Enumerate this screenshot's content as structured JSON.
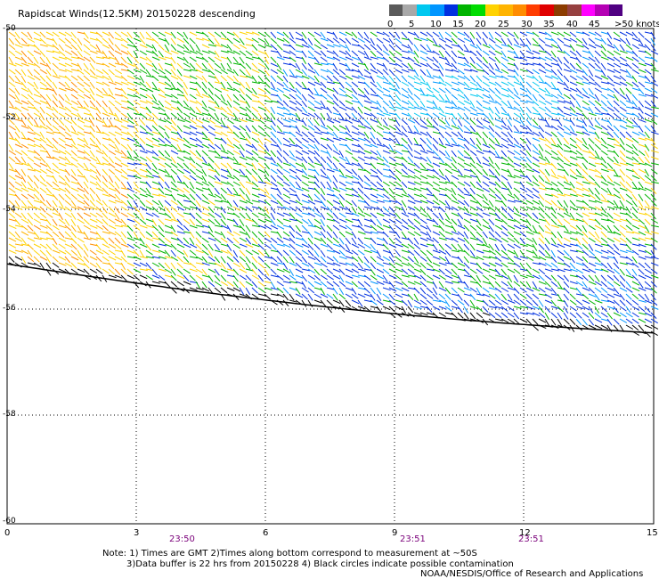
{
  "title": "Rapidscat Winds(12.5KM) 20150228 descending",
  "legend": {
    "colors": [
      "#5a5a5a",
      "#a8a8a8",
      "#00c8f0",
      "#0096ff",
      "#0030e0",
      "#00b400",
      "#00dc00",
      "#ffd200",
      "#ffb400",
      "#ff8c00",
      "#ff3c00",
      "#e00000",
      "#8c3c00",
      "#964040",
      "#ff00ff",
      "#b400b4",
      "#500082"
    ],
    "labels": [
      "0",
      "5",
      "10",
      "15",
      "20",
      "25",
      "30",
      "35",
      "40",
      "45",
      ">50 knots"
    ]
  },
  "y_axis": {
    "labels": [
      "-50",
      "-52",
      "-54",
      "-56",
      "-58",
      "-60"
    ]
  },
  "x_axis": {
    "labels": [
      "0",
      "3",
      "6",
      "9",
      "12",
      "15"
    ]
  },
  "times": [
    "23:50",
    "23:51",
    "23:51"
  ],
  "notes": [
    "Note: 1) Times are GMT 2)Times along bottom correspond to measurement at ~50S",
    "3)Data buffer is 22 hrs from 20150228 4) Black circles indicate possible contamination"
  ],
  "credit": "NOAA/NESDIS/Office of Research and Applications",
  "map": {
    "lat_range": [
      -60,
      -50
    ],
    "lon_range": [
      0,
      15
    ],
    "gridlines": true
  }
}
